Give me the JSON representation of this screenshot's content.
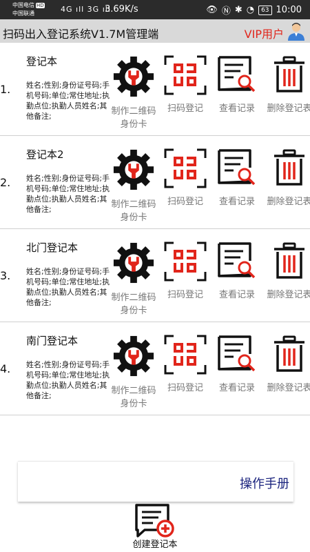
{
  "status_bar": {
    "carrier1": "中国电信",
    "carrier1_badge": "HD",
    "carrier2": "中国联通",
    "signal": "4G ıll 3G ıll",
    "net_speed": "3.69K/s",
    "battery": "63",
    "time": "10:00"
  },
  "header": {
    "title": "扫码出入登记系统V1.7M管理端",
    "vip_label": "VIP用户"
  },
  "colors": {
    "accent_red": "#e1251b",
    "link_blue": "#1a237e",
    "header_bg": "#d9d9d9"
  },
  "actions": {
    "make_card": "制作二维码身份卡",
    "scan": "扫码登记",
    "view": "查看记录",
    "delete": "删除登记表"
  },
  "registers": [
    {
      "index": "1.",
      "name": "登记本",
      "fields": "姓名;性别;身份证号码;手机号码;单位;常住地址;执勤点位;执勤人员姓名;其他备注;"
    },
    {
      "index": "2.",
      "name": "登记本2",
      "fields": "姓名;性别;身份证号码;手机号码;单位;常住地址;执勤点位;执勤人员姓名;其他备注;"
    },
    {
      "index": "3.",
      "name": "北门登记本",
      "fields": "姓名;性别;身份证号码;手机号码;单位;常住地址;执勤点位;执勤人员姓名;其他备注;"
    },
    {
      "index": "4.",
      "name": "南门登记本",
      "fields": "姓名;性别;身份证号码;手机号码;单位;常住地址;执勤点位;执勤人员姓名;其他备注;"
    }
  ],
  "manual_link": "操作手册",
  "create_label": "创建登记本"
}
